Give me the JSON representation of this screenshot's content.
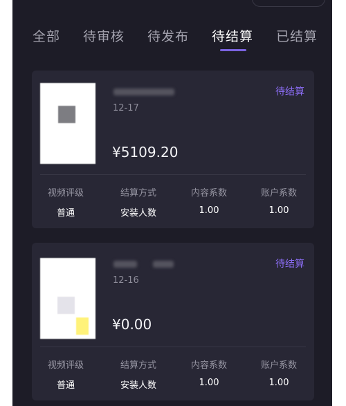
{
  "tabs": [
    {
      "label": "全部"
    },
    {
      "label": "待审核"
    },
    {
      "label": "待发布"
    },
    {
      "label": "待结算"
    },
    {
      "label": "已结算"
    }
  ],
  "active_tab": "待结算",
  "cards": [
    {
      "date": "12-17",
      "status": "待结算",
      "amount": "¥5109.20",
      "stats": [
        {
          "label": "视频评级",
          "value": "普通"
        },
        {
          "label": "结算方式",
          "value": "安装人数"
        },
        {
          "label": "内容系数",
          "value": "1.00"
        },
        {
          "label": "账户系数",
          "value": "1.00"
        }
      ]
    },
    {
      "date": "12-16",
      "status": "待结算",
      "amount": "¥0.00",
      "stats": [
        {
          "label": "视频评级",
          "value": "普通"
        },
        {
          "label": "结算方式",
          "value": "安装人数"
        },
        {
          "label": "内容系数",
          "value": "1.00"
        },
        {
          "label": "账户系数",
          "value": "1.00"
        }
      ]
    }
  ],
  "colors": {
    "background": "#1d1c27",
    "card": "#282735",
    "accent": "#7b63e0",
    "status": "#8a6cf2"
  }
}
